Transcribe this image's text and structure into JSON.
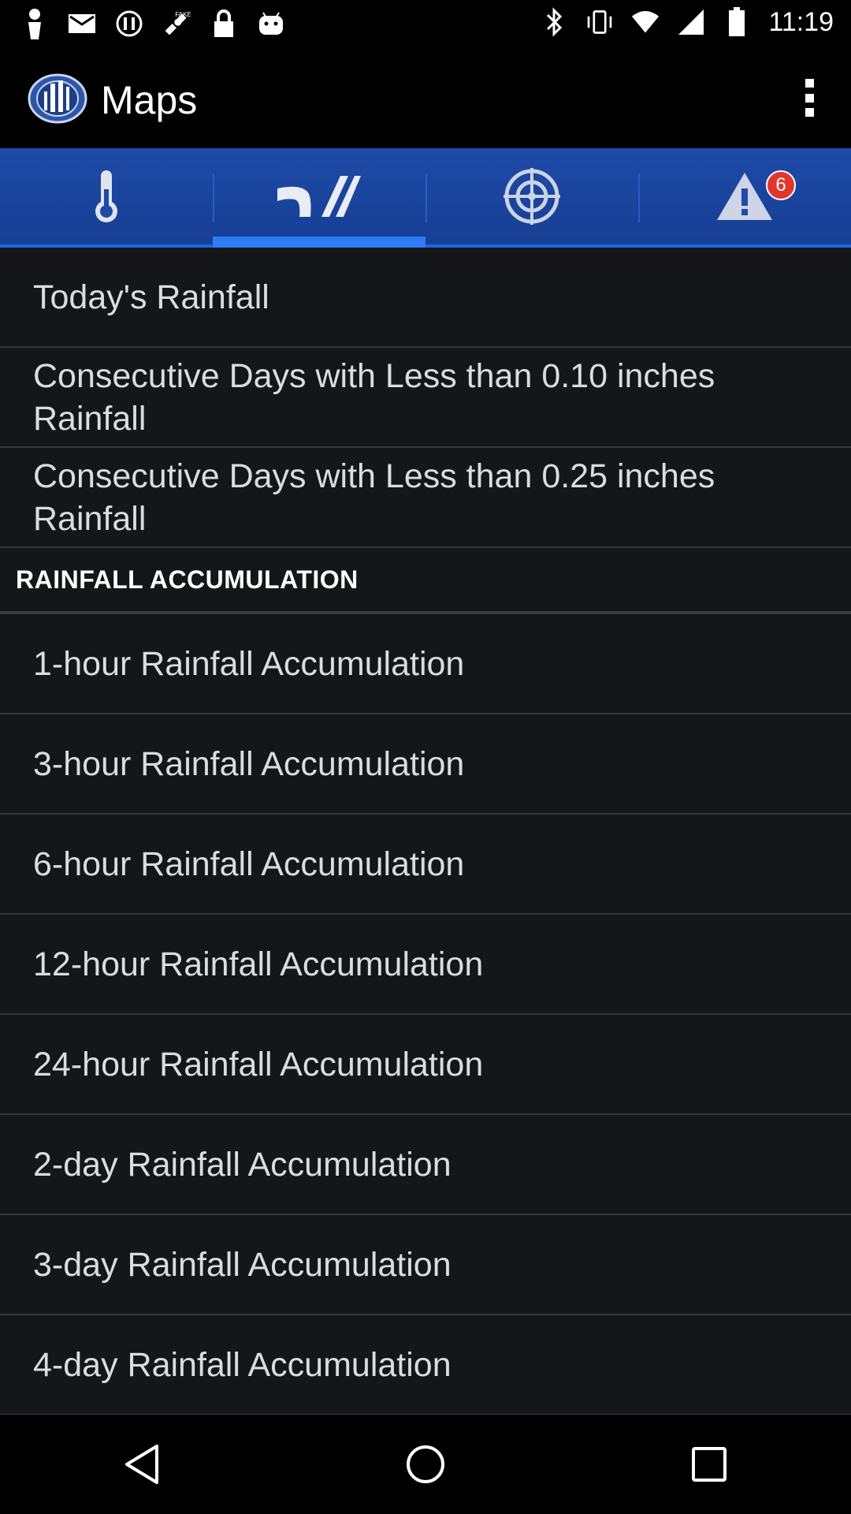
{
  "status_bar": {
    "time": "11:19",
    "left_icons": [
      "person-icon",
      "mail-icon",
      "dnd-icon",
      "fake-gps-icon",
      "lock-icon",
      "android-icon"
    ],
    "right_icons": [
      "bluetooth-icon",
      "vibrate-icon",
      "wifi-icon",
      "signal-icon",
      "battery-icon"
    ]
  },
  "app_bar": {
    "title": "Maps",
    "logo": "app-logo-icon",
    "overflow": "overflow-menu-icon"
  },
  "tabs": [
    {
      "name": "temperature",
      "icon": "thermometer-icon",
      "active": false
    },
    {
      "name": "rainfall",
      "icon": "rain-icon",
      "active": true
    },
    {
      "name": "radar",
      "icon": "radar-icon",
      "active": false
    },
    {
      "name": "alerts",
      "icon": "warning-icon",
      "active": false,
      "badge": "6"
    }
  ],
  "colors": {
    "tab_bar": "#1a45a0",
    "active_indicator": "#2e7cf6",
    "list_bg": "#14161a",
    "badge": "#e0362c"
  },
  "list": {
    "top_items": [
      "Today's Rainfall",
      "Consecutive Days with Less than 0.10 inches Rainfall",
      "Consecutive Days with Less than 0.25 inches Rainfall"
    ],
    "section_header": "RAINFALL ACCUMULATION",
    "section_items": [
      "1-hour Rainfall Accumulation",
      "3-hour Rainfall Accumulation",
      "6-hour Rainfall Accumulation",
      "12-hour Rainfall Accumulation",
      "24-hour Rainfall Accumulation",
      "2-day Rainfall Accumulation",
      "3-day Rainfall Accumulation",
      "4-day Rainfall Accumulation"
    ]
  },
  "nav_bar": {
    "buttons": [
      "back-icon",
      "home-icon",
      "recents-icon"
    ]
  }
}
